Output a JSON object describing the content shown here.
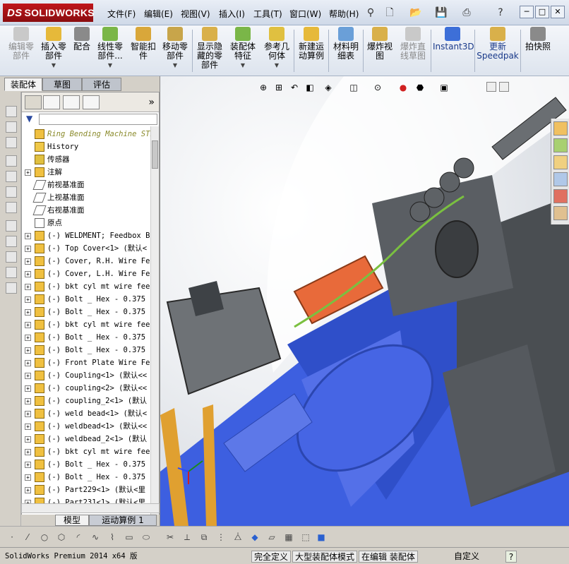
{
  "app": {
    "logo_text": "SOLIDWORKS",
    "logo_prefix": "DS",
    "menus": [
      "文件(F)",
      "编辑(E)",
      "视图(V)",
      "插入(I)",
      "工具(T)",
      "窗口(W)",
      "帮助(H)"
    ],
    "window_controls": {
      "minimize": "─",
      "restore": "□",
      "close": "✕"
    }
  },
  "ribbon": {
    "buttons": [
      {
        "label": "编辑零\n部件",
        "enabled": false
      },
      {
        "label": "插入零\n部件",
        "enabled": true
      },
      {
        "label": "配合",
        "enabled": true
      },
      {
        "label": "线性零\n部件...",
        "enabled": true
      },
      {
        "label": "智能扣\n件",
        "enabled": true
      },
      {
        "label": "移动零\n部件",
        "enabled": true
      },
      {
        "label": "显示隐\n藏的零\n部件",
        "enabled": true
      },
      {
        "label": "装配体\n特征",
        "enabled": true
      },
      {
        "label": "参考几\n何体",
        "enabled": true
      },
      {
        "label": "新建运\n动算例",
        "enabled": true
      },
      {
        "label": "材料明\n细表",
        "enabled": true
      },
      {
        "label": "爆炸视\n图",
        "enabled": true
      },
      {
        "label": "爆炸直\n线草图",
        "enabled": false
      },
      {
        "label": "Instant3D",
        "enabled": true
      },
      {
        "label": "更新\nSpeedpak",
        "enabled": true
      },
      {
        "label": "拍快照",
        "enabled": true
      }
    ]
  },
  "left_tabs": [
    "装配体",
    "草图",
    "评估"
  ],
  "tree": {
    "root": "Ring Bending Machine STI",
    "items": [
      {
        "label": "History",
        "type": "folder"
      },
      {
        "label": "传感器",
        "type": "sensor"
      },
      {
        "label": "注解",
        "type": "annotation"
      },
      {
        "label": "前视基准面",
        "type": "plane"
      },
      {
        "label": "上视基准面",
        "type": "plane"
      },
      {
        "label": "右视基准面",
        "type": "plane"
      },
      {
        "label": "原点",
        "type": "origin"
      },
      {
        "label": "(-) WELDMENT; Feedbox B",
        "type": "part"
      },
      {
        "label": "(-) Top Cover<1> (默认<",
        "type": "part"
      },
      {
        "label": "(-) Cover, R.H. Wire Fe",
        "type": "part"
      },
      {
        "label": "(-) Cover, L.H. Wire Fe",
        "type": "part"
      },
      {
        "label": "(-) bkt cyl mt wire fee",
        "type": "part"
      },
      {
        "label": "(-) Bolt _ Hex - 0.375",
        "type": "part"
      },
      {
        "label": "(-) Bolt _ Hex - 0.375",
        "type": "part"
      },
      {
        "label": "(-) bkt cyl mt wire fee",
        "type": "part"
      },
      {
        "label": "(-) Bolt _ Hex - 0.375",
        "type": "part"
      },
      {
        "label": "(-) Bolt _ Hex - 0.375",
        "type": "part"
      },
      {
        "label": "(-) Front Plate Wire Fe",
        "type": "part"
      },
      {
        "label": "(-) Coupling<1> (默认<<",
        "type": "part"
      },
      {
        "label": "(-) coupling<2> (默认<<",
        "type": "part"
      },
      {
        "label": "(-) coupling_2<1> (默认",
        "type": "part"
      },
      {
        "label": "(-) weld bead<1> (默认<",
        "type": "part"
      },
      {
        "label": "(-) weldbead<1> (默认<<",
        "type": "part"
      },
      {
        "label": "(-) weldbead_2<1> (默认",
        "type": "part"
      },
      {
        "label": "(-) bkt cyl mt wire fee",
        "type": "part"
      },
      {
        "label": "(-) Bolt _ Hex - 0.375",
        "type": "part"
      },
      {
        "label": "(-) Bolt _ Hex - 0.375",
        "type": "part"
      },
      {
        "label": "(-) Part229<1> (默认<里",
        "type": "part"
      },
      {
        "label": "(-) Part231<1> (默认<里",
        "type": "part"
      }
    ]
  },
  "bottom_tabs": [
    "模型",
    "运动算例 1"
  ],
  "status": {
    "app_version": "SolidWorks Premium 2014 x64 版",
    "fully_defined": "完全定义",
    "large_assembly": "大型装配体模式",
    "editing": "在编辑 装配体",
    "custom": "自定义",
    "help": "?"
  },
  "colors": {
    "brand_red": "#b3141a",
    "machine_blue": "#3d5fe0",
    "orange_part": "#e86a3a",
    "dark_gray": "#4a4e52"
  }
}
